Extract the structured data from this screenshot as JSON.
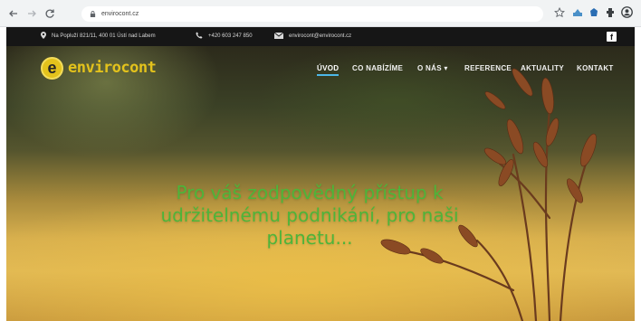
{
  "browser": {
    "url": "envirocont.cz"
  },
  "contact": {
    "address": "Na Popluží 821/11, 400 01 Ústí nad Labem",
    "phone": "+420 603 247 850",
    "email": "envirocont@envirocont.cz",
    "social": "f"
  },
  "logo": {
    "mark": "e",
    "text": "envirocont"
  },
  "menu": {
    "items": [
      "ÚVOD",
      "CO NABÍZÍME",
      "O NÁS ▾",
      "REFERENCE",
      "AKTUALITY",
      "KONTAKT"
    ],
    "active_index": 0
  },
  "hero": {
    "headline_lines": [
      "Pro váš zodpovědný přístup k",
      "udržitelnému podnikání, pro naši",
      "planetu..."
    ]
  },
  "colors": {
    "accent_green": "#4db53a",
    "logo_yellow": "#e3c21c",
    "menu_active_underline": "#4db8e8",
    "contact_bar": "#161616"
  },
  "icons": [
    "back-arrow-icon",
    "forward-arrow-icon",
    "reload-icon",
    "lock-icon",
    "star-icon",
    "extension-icon",
    "profile-icon",
    "map-pin-icon",
    "phone-icon",
    "mail-icon",
    "facebook-icon"
  ]
}
